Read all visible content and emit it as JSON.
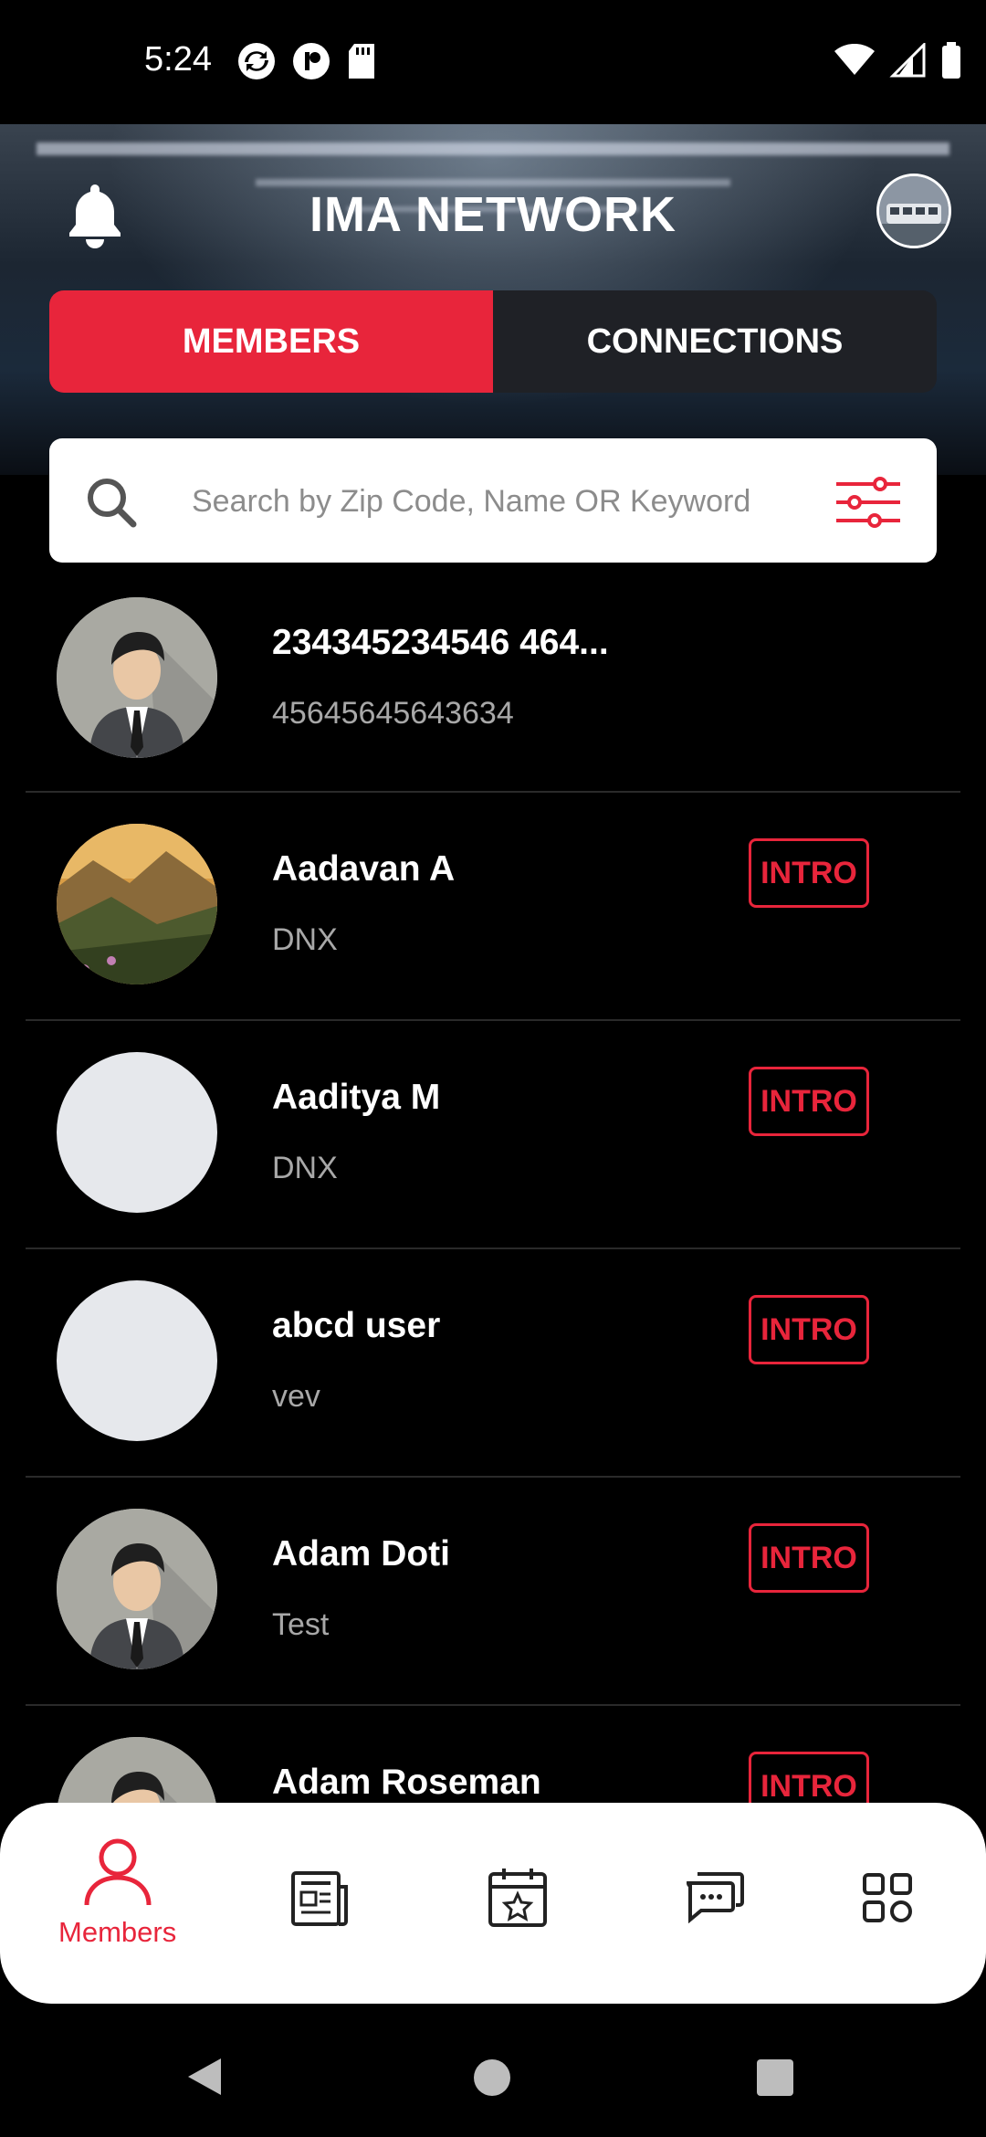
{
  "status_bar": {
    "time": "5:24"
  },
  "header": {
    "title": "IMA NETWORK"
  },
  "tabs": [
    {
      "label": "MEMBERS",
      "active": true
    },
    {
      "label": "CONNECTIONS",
      "active": false
    }
  ],
  "search": {
    "placeholder": "Search by Zip Code, Name OR Keyword"
  },
  "members": [
    {
      "name": "234345234546 464...",
      "subtitle": "45645645643634",
      "avatar": "default-person",
      "intro": ""
    },
    {
      "name": "Aadavan A",
      "subtitle": "DNX",
      "avatar": "landscape-photo",
      "intro": "INTRO"
    },
    {
      "name": "Aaditya M",
      "subtitle": "DNX",
      "avatar": "blank",
      "intro": "INTRO"
    },
    {
      "name": "abcd user",
      "subtitle": "vev",
      "avatar": "blank",
      "intro": "INTRO"
    },
    {
      "name": "Adam Doti",
      "subtitle": "Test",
      "avatar": "default-person",
      "intro": "INTRO"
    },
    {
      "name": "Adam Roseman",
      "subtitle": "",
      "avatar": "default-person",
      "intro": "INTRO"
    }
  ],
  "bottom_nav": {
    "members_label": "Members",
    "items": [
      "members-icon",
      "news-icon",
      "events-icon",
      "chat-icon",
      "more-grid-icon"
    ]
  },
  "colors": {
    "accent": "#e8253b",
    "background": "#000000"
  }
}
